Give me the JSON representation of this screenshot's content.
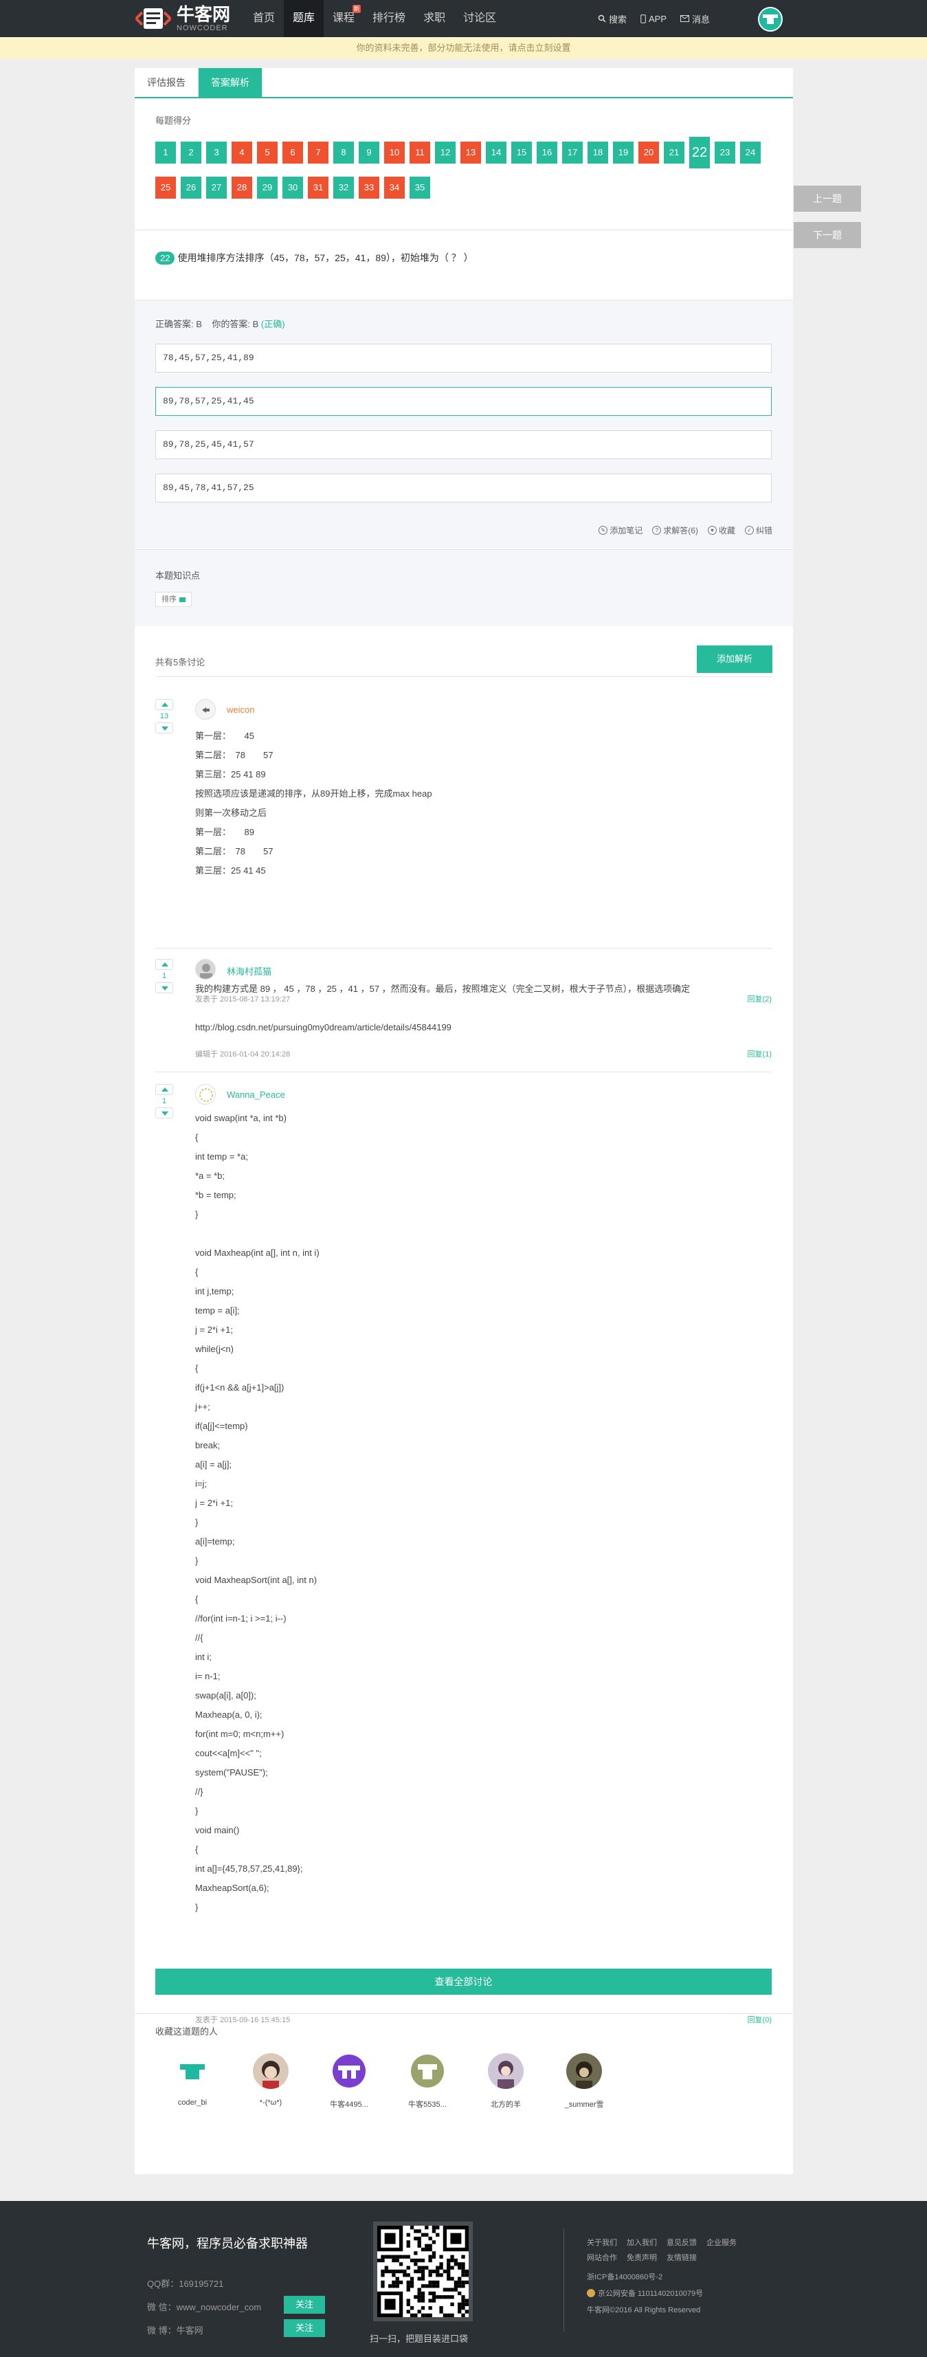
{
  "nav": {
    "logo_title": "牛客网",
    "logo_sub": "NOWCODER",
    "links": [
      "首页",
      "题库",
      "课程",
      "排行榜",
      "求职",
      "讨论区"
    ],
    "course_badge": "新",
    "search": "搜索",
    "app": "APP",
    "msg": "消息"
  },
  "notice": {
    "text": "你的资料未完善，部分功能无法使用，请点击",
    "link": "立刻设置"
  },
  "tabs": [
    "评估报告",
    "答案解析"
  ],
  "score": {
    "label": "每题得分",
    "cells": [
      {
        "n": "1",
        "s": "ok"
      },
      {
        "n": "2",
        "s": "ok"
      },
      {
        "n": "3",
        "s": "ok"
      },
      {
        "n": "4",
        "s": "bad"
      },
      {
        "n": "5",
        "s": "bad"
      },
      {
        "n": "6",
        "s": "bad"
      },
      {
        "n": "7",
        "s": "bad"
      },
      {
        "n": "8",
        "s": "ok"
      },
      {
        "n": "9",
        "s": "ok"
      },
      {
        "n": "10",
        "s": "bad"
      },
      {
        "n": "11",
        "s": "bad"
      },
      {
        "n": "12",
        "s": "ok"
      },
      {
        "n": "13",
        "s": "bad"
      },
      {
        "n": "14",
        "s": "ok"
      },
      {
        "n": "15",
        "s": "ok"
      },
      {
        "n": "16",
        "s": "ok"
      },
      {
        "n": "17",
        "s": "ok"
      },
      {
        "n": "18",
        "s": "ok"
      },
      {
        "n": "19",
        "s": "ok"
      },
      {
        "n": "20",
        "s": "bad"
      },
      {
        "n": "21",
        "s": "ok"
      },
      {
        "n": "22",
        "s": "cur"
      },
      {
        "n": "23",
        "s": "ok"
      },
      {
        "n": "24",
        "s": "ok"
      },
      {
        "n": "25",
        "s": "bad"
      },
      {
        "n": "26",
        "s": "ok"
      },
      {
        "n": "27",
        "s": "ok"
      },
      {
        "n": "28",
        "s": "bad"
      },
      {
        "n": "29",
        "s": "ok"
      },
      {
        "n": "30",
        "s": "ok"
      },
      {
        "n": "31",
        "s": "bad"
      },
      {
        "n": "32",
        "s": "ok"
      },
      {
        "n": "33",
        "s": "bad"
      },
      {
        "n": "34",
        "s": "bad"
      },
      {
        "n": "35",
        "s": "ok"
      }
    ]
  },
  "side": {
    "prev": "上一题",
    "next": "下一题"
  },
  "question": {
    "num": "22",
    "text": "使用堆排序方法排序（45，78，57，25，41，89），初始堆为（ ？ ）"
  },
  "answer": {
    "correct": "正确答案: B",
    "yours": "你的答案: B",
    "status": "(正确)"
  },
  "options": [
    "78,45,57,25,41,89",
    "89,78,57,25,41,45",
    "89,78,25,45,41,57",
    "89,45,78,41,57,25"
  ],
  "tools": [
    "添加笔记",
    "求解答(6)",
    "收藏",
    "纠错"
  ],
  "knowledge": {
    "label": "本题知识点",
    "tag": "排序"
  },
  "discuss": {
    "count": "共有5条讨论",
    "add": "添加解析",
    "all": "查看全部讨论"
  },
  "comments": [
    {
      "votes": "13",
      "name": "weicon",
      "lines": [
        "第一层：　　45",
        "第二层：　78　　57",
        "第三层：25 41  89",
        "按照选项应该是递减的排序，从89开始上移，完成max heap",
        "则第一次移动之后",
        "第一层：　　89",
        "第二层：　78　　57",
        "第三层：25 41  45"
      ],
      "date": "发表于 2015-08-17 13:19:27",
      "reply": "回复(2)"
    },
    {
      "votes": "1",
      "name": "林海村孤猫",
      "lines": [
        "我的构建方式是 89 ， 45 ，78 ，25 ，41 ，57 ，然而没有。最后，按照堆定义（完全二叉树，根大于子节点），根据选项确定",
        "",
        "http://blog.csdn.net/pursuing0my0dream/article/details/45844199"
      ],
      "date": "编辑于 2016-01-04 20:14:28",
      "reply": "回复(1)"
    },
    {
      "votes": "1",
      "name": "Wanna_Peace",
      "lines": [
        "void swap(int *a, int *b)",
        "{",
        "int temp = *a;",
        "*a = *b;",
        "*b = temp;",
        "}",
        "",
        "void Maxheap(int a[], int n, int i)",
        "{",
        "int j,temp;",
        "temp = a[i];",
        "j = 2*i +1;",
        "while(j<n)",
        "{",
        "if(j+1<n && a[j+1]>a[j])",
        "j++;",
        "if(a[j]<=temp)",
        "break;",
        "a[i] = a[j];",
        "i=j;",
        "j = 2*i +1;",
        "}",
        "a[i]=temp;",
        "}",
        "void MaxheapSort(int a[], int n)",
        "{",
        "//for(int i=n-1; i >=1; i--)",
        "//{",
        "int i;",
        "i= n-1;",
        "swap(a[i], a[0]);",
        "Maxheap(a, 0, i);",
        "for(int m=0; m<n;m++)",
        "cout<<a[m]<<\" \";",
        "system(\"PAUSE\");",
        "//}",
        "}",
        "void main()",
        "{",
        "int a[]={45,78,57,25,41,89};",
        "MaxheapSort(a,6);",
        "}"
      ],
      "date": "发表于 2015-09-16 15:45:15",
      "reply": "回复(0)"
    }
  ],
  "followers": {
    "label": "收藏这道题的人",
    "names": [
      "coder_bi",
      "*-(*ω*)",
      "牛客4495...",
      "牛客5535...",
      "北方的羊",
      "_summer雪"
    ]
  },
  "footer": {
    "slogan": "牛客网，程序员必备求职神器",
    "qq": "QQ群：169195721",
    "weixin": "微 信：www_nowcoder_com",
    "weibo": "微 博：牛客网",
    "follow": "关注",
    "qr_caption": "扫一扫，把题目装进口袋",
    "links1": [
      "关于我们",
      "加入我们",
      "意见反馈",
      "企业服务"
    ],
    "links2": [
      "网站合作",
      "免责声明",
      "友情链接"
    ],
    "icp": "浙ICP备14000860号-2",
    "police": "京公网安备 11011402010079号",
    "copyright": "牛客网©2016 All Rights Reserved"
  },
  "colors": {
    "accent": "#25bb9b",
    "wrong": "#f0522f",
    "nav": "#2b3034"
  }
}
